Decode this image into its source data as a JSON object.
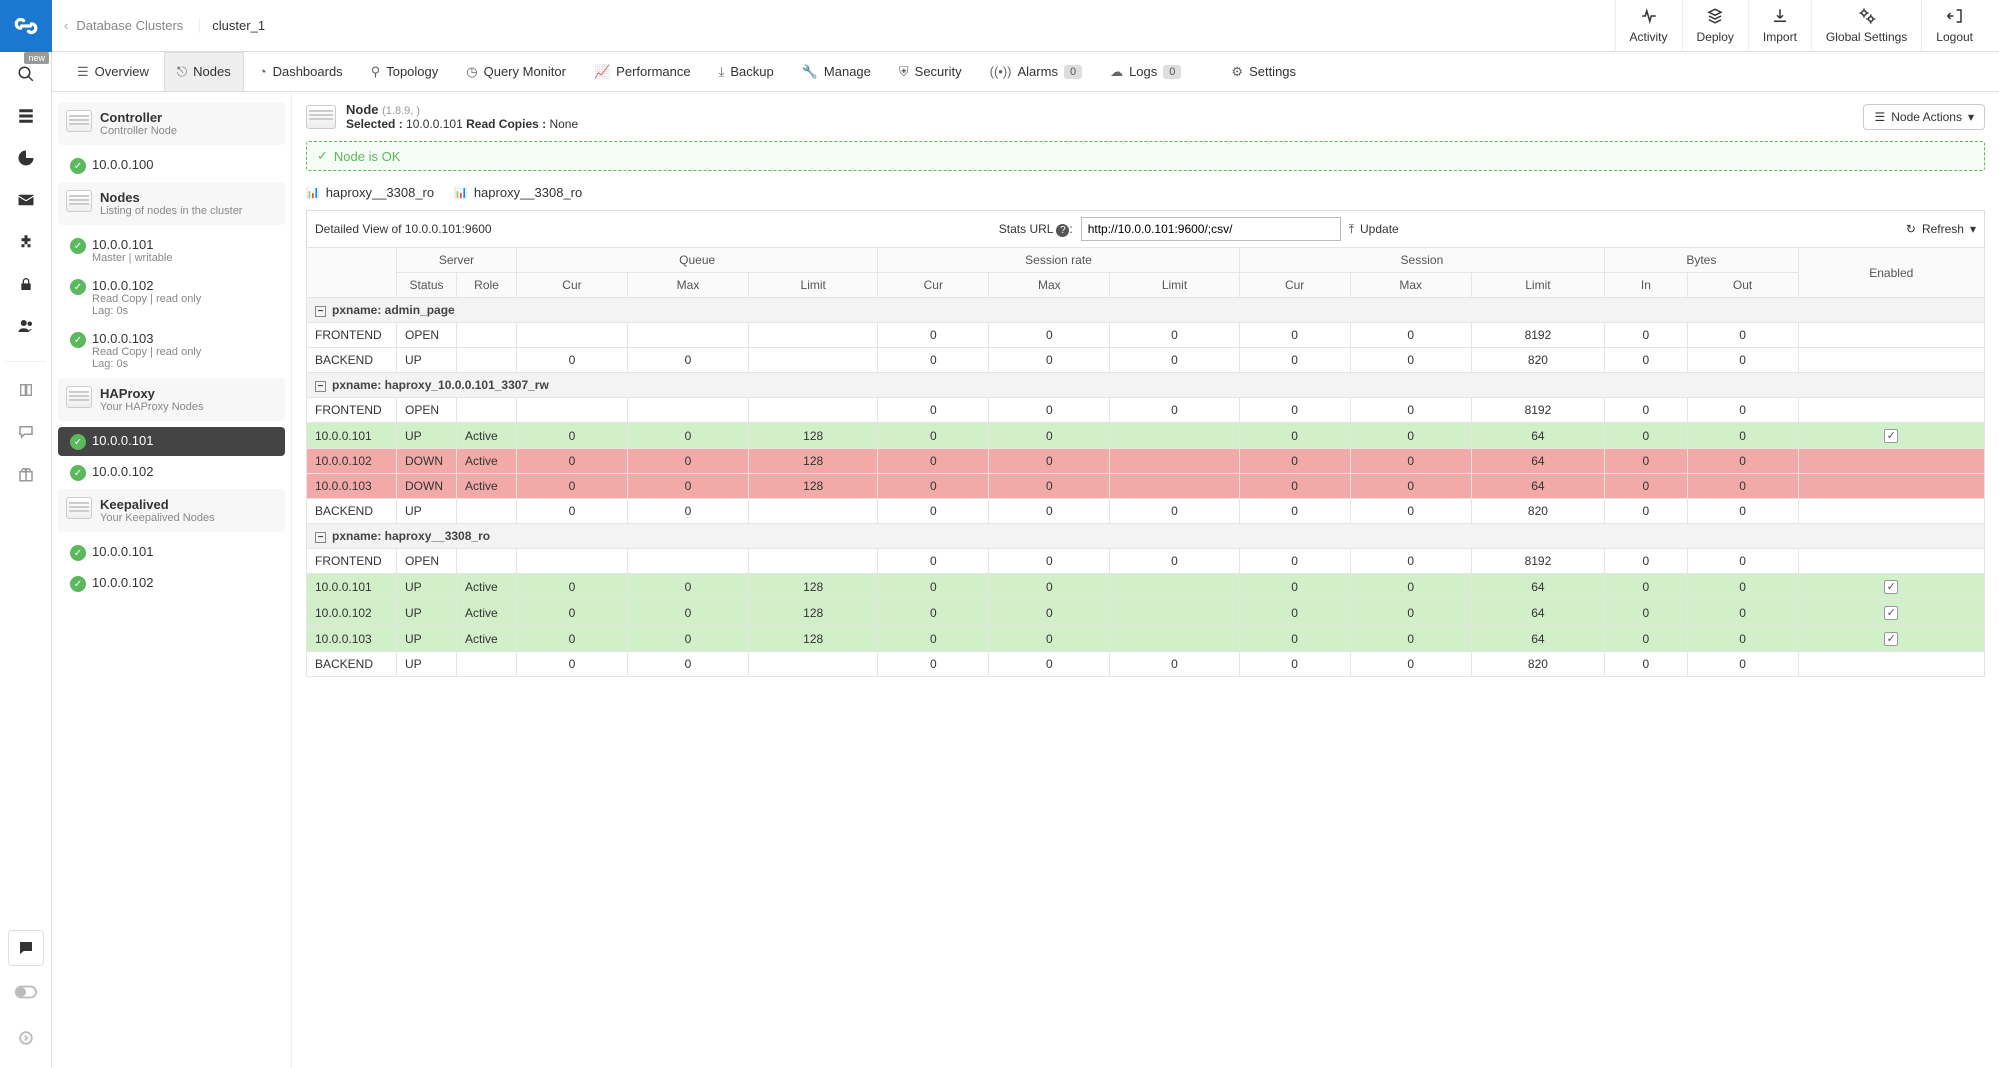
{
  "breadcrumb": {
    "back": "Database Clusters",
    "current": "cluster_1"
  },
  "top_actions": {
    "activity": "Activity",
    "deploy": "Deploy",
    "import": "Import",
    "global": "Global Settings",
    "logout": "Logout"
  },
  "rail_badge": "new",
  "tabs": {
    "overview": "Overview",
    "nodes": "Nodes",
    "dashboards": "Dashboards",
    "topology": "Topology",
    "query": "Query Monitor",
    "performance": "Performance",
    "backup": "Backup",
    "manage": "Manage",
    "security": "Security",
    "alarms": "Alarms",
    "alarms_badge": "0",
    "logs": "Logs",
    "logs_badge": "0",
    "settings": "Settings"
  },
  "sidebar": {
    "controller": {
      "title": "Controller",
      "sub": "Controller Node"
    },
    "controller_nodes": [
      {
        "ip": "10.0.0.100"
      }
    ],
    "nodes_group": {
      "title": "Nodes",
      "sub": "Listing of nodes in the cluster"
    },
    "db_nodes": [
      {
        "ip": "10.0.0.101",
        "sub": "Master | writable"
      },
      {
        "ip": "10.0.0.102",
        "sub": "Read Copy | read only",
        "sub2": "Lag: 0s"
      },
      {
        "ip": "10.0.0.103",
        "sub": "Read Copy | read only",
        "sub2": "Lag: 0s"
      }
    ],
    "haproxy_group": {
      "title": "HAProxy",
      "sub": "Your HAProxy Nodes"
    },
    "haproxy_nodes": [
      {
        "ip": "10.0.0.101",
        "active": true
      },
      {
        "ip": "10.0.0.102"
      }
    ],
    "keepalived_group": {
      "title": "Keepalived",
      "sub": "Your Keepalived Nodes"
    },
    "keepalived_nodes": [
      {
        "ip": "10.0.0.101"
      },
      {
        "ip": "10.0.0.102"
      }
    ]
  },
  "detail": {
    "node_label": "Node",
    "node_version": "(1.8.9, )",
    "selected_label": "Selected :",
    "selected_ip": "10.0.0.101",
    "read_copies_label": "Read Copies :",
    "read_copies_value": "None",
    "ok_msg": "Node is OK",
    "node_actions_btn": "Node Actions",
    "subtabs": {
      "a": "haproxy__3308_ro",
      "b": "haproxy__3308_ro"
    }
  },
  "toolbar": {
    "detailed_view_prefix": "Detailed View of ",
    "detailed_view_target": "10.0.0.101:9600",
    "stats_label": "Stats URL",
    "stats_value": "http://10.0.0.101:9600/;csv/",
    "update": "Update",
    "refresh": "Refresh"
  },
  "table": {
    "headers": {
      "server": "Server",
      "queue": "Queue",
      "session_rate": "Session rate",
      "session": "Session",
      "bytes": "Bytes",
      "enabled": "Enabled",
      "status": "Status",
      "role": "Role",
      "cur": "Cur",
      "max": "Max",
      "limit": "Limit",
      "in": "In",
      "out": "Out"
    },
    "sections": [
      {
        "title": "pxname: admin_page",
        "rows": [
          {
            "name": "FRONTEND",
            "status": "OPEN",
            "role": "",
            "qcur": "",
            "qmax": "",
            "qlim": "",
            "rcur": "0",
            "rmax": "0",
            "rlim": "0",
            "scur": "0",
            "smax": "0",
            "slim": "8192",
            "bin": "0",
            "bout": "0",
            "enabled": null,
            "color": ""
          },
          {
            "name": "BACKEND",
            "status": "UP",
            "role": "",
            "qcur": "0",
            "qmax": "0",
            "qlim": "",
            "rcur": "0",
            "rmax": "0",
            "rlim": "0",
            "scur": "0",
            "smax": "0",
            "slim": "820",
            "bin": "0",
            "bout": "0",
            "enabled": null,
            "color": ""
          }
        ]
      },
      {
        "title": "pxname: haproxy_10.0.0.101_3307_rw",
        "rows": [
          {
            "name": "FRONTEND",
            "status": "OPEN",
            "role": "",
            "qcur": "",
            "qmax": "",
            "qlim": "",
            "rcur": "0",
            "rmax": "0",
            "rlim": "0",
            "scur": "0",
            "smax": "0",
            "slim": "8192",
            "bin": "0",
            "bout": "0",
            "enabled": null,
            "color": ""
          },
          {
            "name": "10.0.0.101",
            "status": "UP",
            "role": "Active",
            "qcur": "0",
            "qmax": "0",
            "qlim": "128",
            "rcur": "0",
            "rmax": "0",
            "rlim": "",
            "scur": "0",
            "smax": "0",
            "slim": "64",
            "bin": "0",
            "bout": "0",
            "enabled": true,
            "color": "up"
          },
          {
            "name": "10.0.0.102",
            "status": "DOWN",
            "role": "Active",
            "qcur": "0",
            "qmax": "0",
            "qlim": "128",
            "rcur": "0",
            "rmax": "0",
            "rlim": "",
            "scur": "0",
            "smax": "0",
            "slim": "64",
            "bin": "0",
            "bout": "0",
            "enabled": null,
            "color": "down"
          },
          {
            "name": "10.0.0.103",
            "status": "DOWN",
            "role": "Active",
            "qcur": "0",
            "qmax": "0",
            "qlim": "128",
            "rcur": "0",
            "rmax": "0",
            "rlim": "",
            "scur": "0",
            "smax": "0",
            "slim": "64",
            "bin": "0",
            "bout": "0",
            "enabled": null,
            "color": "down"
          },
          {
            "name": "BACKEND",
            "status": "UP",
            "role": "",
            "qcur": "0",
            "qmax": "0",
            "qlim": "",
            "rcur": "0",
            "rmax": "0",
            "rlim": "0",
            "scur": "0",
            "smax": "0",
            "slim": "820",
            "bin": "0",
            "bout": "0",
            "enabled": null,
            "color": ""
          }
        ]
      },
      {
        "title": "pxname: haproxy__3308_ro",
        "rows": [
          {
            "name": "FRONTEND",
            "status": "OPEN",
            "role": "",
            "qcur": "",
            "qmax": "",
            "qlim": "",
            "rcur": "0",
            "rmax": "0",
            "rlim": "0",
            "scur": "0",
            "smax": "0",
            "slim": "8192",
            "bin": "0",
            "bout": "0",
            "enabled": null,
            "color": ""
          },
          {
            "name": "10.0.0.101",
            "status": "UP",
            "role": "Active",
            "qcur": "0",
            "qmax": "0",
            "qlim": "128",
            "rcur": "0",
            "rmax": "0",
            "rlim": "",
            "scur": "0",
            "smax": "0",
            "slim": "64",
            "bin": "0",
            "bout": "0",
            "enabled": true,
            "color": "up"
          },
          {
            "name": "10.0.0.102",
            "status": "UP",
            "role": "Active",
            "qcur": "0",
            "qmax": "0",
            "qlim": "128",
            "rcur": "0",
            "rmax": "0",
            "rlim": "",
            "scur": "0",
            "smax": "0",
            "slim": "64",
            "bin": "0",
            "bout": "0",
            "enabled": true,
            "color": "up"
          },
          {
            "name": "10.0.0.103",
            "status": "UP",
            "role": "Active",
            "qcur": "0",
            "qmax": "0",
            "qlim": "128",
            "rcur": "0",
            "rmax": "0",
            "rlim": "",
            "scur": "0",
            "smax": "0",
            "slim": "64",
            "bin": "0",
            "bout": "0",
            "enabled": true,
            "color": "up"
          },
          {
            "name": "BACKEND",
            "status": "UP",
            "role": "",
            "qcur": "0",
            "qmax": "0",
            "qlim": "",
            "rcur": "0",
            "rmax": "0",
            "rlim": "0",
            "scur": "0",
            "smax": "0",
            "slim": "820",
            "bin": "0",
            "bout": "0",
            "enabled": null,
            "color": ""
          }
        ]
      }
    ]
  }
}
